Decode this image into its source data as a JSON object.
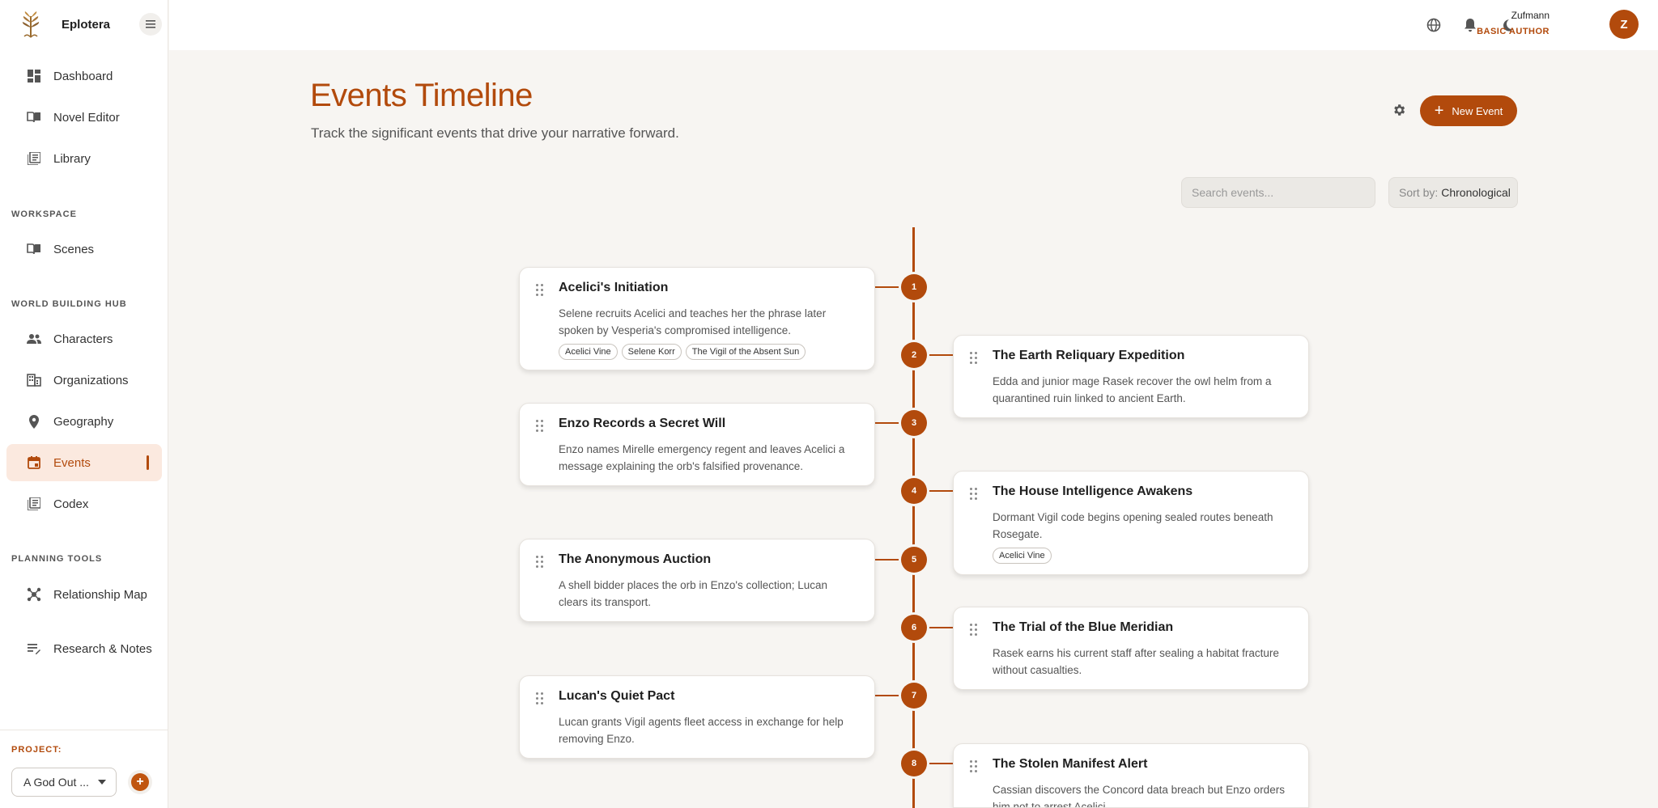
{
  "brand": {
    "name": "Eplotera"
  },
  "nav": {
    "main": [
      {
        "label": "Dashboard",
        "icon": "dashboard-icon"
      },
      {
        "label": "Novel Editor",
        "icon": "book-icon"
      },
      {
        "label": "Library",
        "icon": "library-icon"
      }
    ],
    "workspace_label": "WORKSPACE",
    "workspace": [
      {
        "label": "Scenes",
        "icon": "book-icon"
      }
    ],
    "worldbuilding_label": "WORLD BUILDING HUB",
    "worldbuilding": [
      {
        "label": "Characters",
        "icon": "people-icon"
      },
      {
        "label": "Organizations",
        "icon": "building-icon"
      },
      {
        "label": "Geography",
        "icon": "location-pin-icon"
      },
      {
        "label": "Events",
        "icon": "calendar-icon",
        "active": true
      },
      {
        "label": "Codex",
        "icon": "library-icon"
      }
    ],
    "planning_label": "PLANNING TOOLS",
    "planning": [
      {
        "label": "Relationship Map",
        "icon": "network-icon"
      },
      {
        "label": "Research & Notes",
        "icon": "notes-icon"
      }
    ]
  },
  "project": {
    "label": "PROJECT:",
    "selected": "A God Out ..."
  },
  "user": {
    "name": "Zufmann",
    "role": "BASIC AUTHOR",
    "initial": "Z"
  },
  "page": {
    "title": "Events Timeline",
    "subtitle": "Track the significant events that drive your narrative forward.",
    "new_event_label": "New Event",
    "search_placeholder": "Search events...",
    "sort_prefix": "Sort by:",
    "sort_value": "Chronological"
  },
  "events": [
    {
      "num": "1",
      "title": "Acelici's Initiation",
      "desc": "Selene recruits Acelici and teaches her the phrase later spoken by Vesperia's compromised intelligence.",
      "tags": [
        "Acelici Vine",
        "Selene Korr",
        "The Vigil of the Absent Sun"
      ]
    },
    {
      "num": "2",
      "title": "The Earth Reliquary Expedition",
      "desc": "Edda and junior mage Rasek recover the owl helm from a quarantined ruin linked to ancient Earth.",
      "tags": []
    },
    {
      "num": "3",
      "title": "Enzo Records a Secret Will",
      "desc": "Enzo names Mirelle emergency regent and leaves Acelici a message explaining the orb's falsified provenance.",
      "tags": []
    },
    {
      "num": "4",
      "title": "The House Intelligence Awakens",
      "desc": "Dormant Vigil code begins opening sealed routes beneath Rosegate.",
      "tags": [
        "Acelici Vine"
      ]
    },
    {
      "num": "5",
      "title": "The Anonymous Auction",
      "desc": "A shell bidder places the orb in Enzo's collection; Lucan clears its transport.",
      "tags": []
    },
    {
      "num": "6",
      "title": "The Trial of the Blue Meridian",
      "desc": "Rasek earns his current staff after sealing a habitat fracture without casualties.",
      "tags": []
    },
    {
      "num": "7",
      "title": "Lucan's Quiet Pact",
      "desc": "Lucan grants Vigil agents fleet access in exchange for help removing Enzo.",
      "tags": []
    },
    {
      "num": "8",
      "title": "The Stolen Manifest Alert",
      "desc": "Cassian discovers the Concord data breach but Enzo orders him not to arrest Acelici.",
      "tags": []
    }
  ]
}
